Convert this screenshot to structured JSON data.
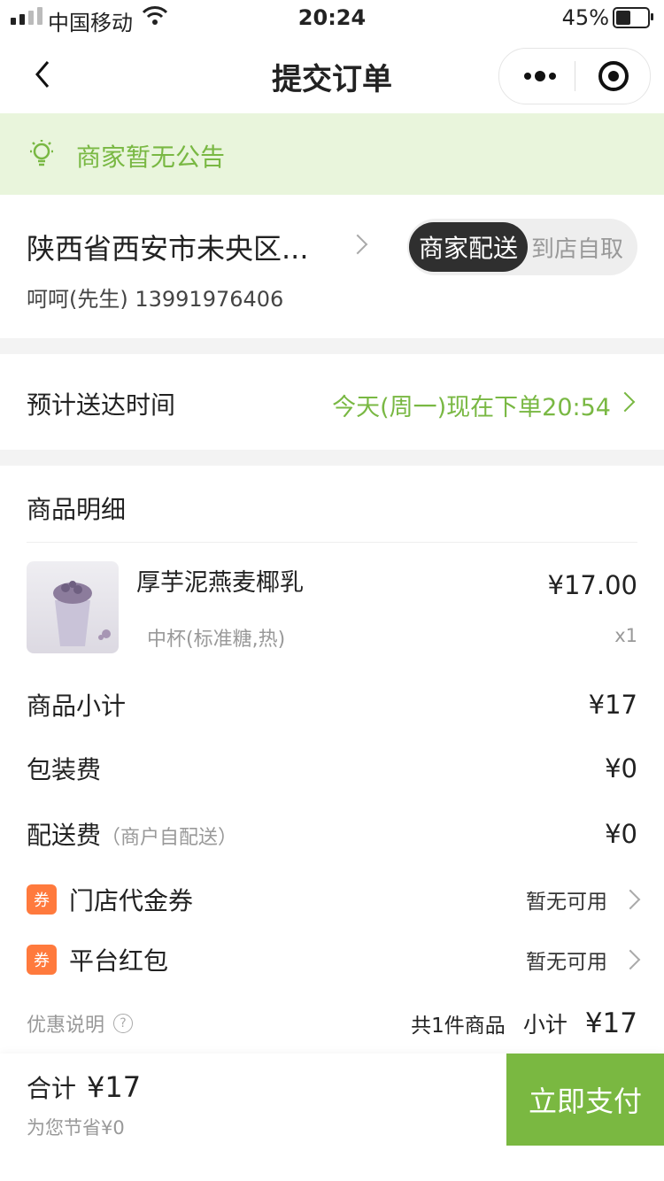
{
  "status_bar": {
    "carrier": "中国移动",
    "time": "20:24",
    "battery_percent": "45%"
  },
  "navbar": {
    "title": "提交订单"
  },
  "notice": {
    "text": "商家暂无公告"
  },
  "address": {
    "text": "陕西省西安市未央区...",
    "contact": "呵呵(先生) 13991976406"
  },
  "delivery_mode": {
    "selected": "商家配送",
    "other": "到店自取"
  },
  "delivery_time": {
    "label": "预计送达时间",
    "value": "今天(周一)现在下单20:54"
  },
  "details": {
    "header": "商品明细",
    "item": {
      "name": "厚芋泥燕麦椰乳",
      "spec": "中杯(标准糖,热)",
      "price": "¥17.00",
      "qty": "x1"
    },
    "subtotal_label": "商品小计",
    "subtotal_value": "¥17",
    "packing_label": "包装费",
    "packing_value": "¥0",
    "delivery_fee_label": "配送费",
    "delivery_fee_note": "（商户自配送）",
    "delivery_fee_value": "¥0",
    "coupon_store_label": "门店代金券",
    "coupon_store_value": "暂无可用",
    "coupon_platform_label": "平台红包",
    "coupon_platform_value": "暂无可用",
    "coupon_badge": "券",
    "discount_note": "优惠说明",
    "count_text": "共1件商品",
    "sub_label": "小计",
    "sub_value": "¥17"
  },
  "bottom_bar": {
    "total_label": "合计",
    "total_value": "¥17",
    "saved": "为您节省¥0",
    "pay_button": "立即支付"
  },
  "colors": {
    "accent_green": "#79b843",
    "notice_bg": "#e9f5dc",
    "coupon_badge": "#ff7a3d",
    "segment_dark": "#2f2f2f"
  },
  "icons": [
    "signal-icon",
    "wifi-icon",
    "battery-icon",
    "back-icon",
    "more-icon",
    "target-icon",
    "bulb-icon",
    "chevron-right-icon",
    "help-circle-icon"
  ]
}
